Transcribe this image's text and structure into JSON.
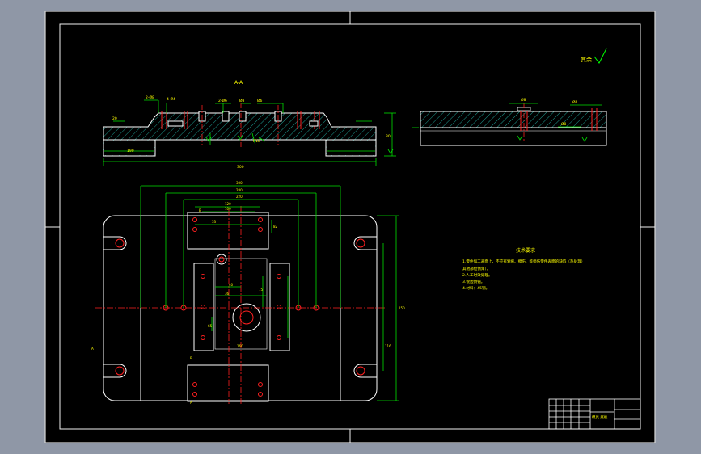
{
  "viewport": {
    "background_color": "#8f97a6",
    "sheet_color": "#000000",
    "frame_color": "#ffffff"
  },
  "section_view": {
    "title": "A-A",
    "dims": [
      "2-Ø8",
      "4-Ø4",
      "2-Ø6",
      "Ø8",
      "Ø6",
      "190",
      "R18",
      "30",
      "300",
      "20"
    ]
  },
  "side_view": {
    "dims": [
      "Ø8",
      "Ø4",
      "Ø8"
    ]
  },
  "plan_view": {
    "dims": [
      "300",
      "280",
      "220",
      "120",
      "100",
      "53",
      "82",
      "40",
      "36",
      "75",
      "150",
      "116",
      "65",
      "160",
      "A",
      "A",
      "B",
      "B"
    ]
  },
  "roughness_mark": "其余",
  "notes": {
    "title": "技术要求",
    "items": [
      "1.零件加工表面上，不应有划痕、擦伤、等损伤零件表面的缺陷（热处理）",
      "其他部位倒角）。",
      "2.人工时效处理。",
      "3.锐边倒钝。",
      "4.材料：45钢。"
    ]
  },
  "title_block": {
    "label": "模具 底板"
  }
}
